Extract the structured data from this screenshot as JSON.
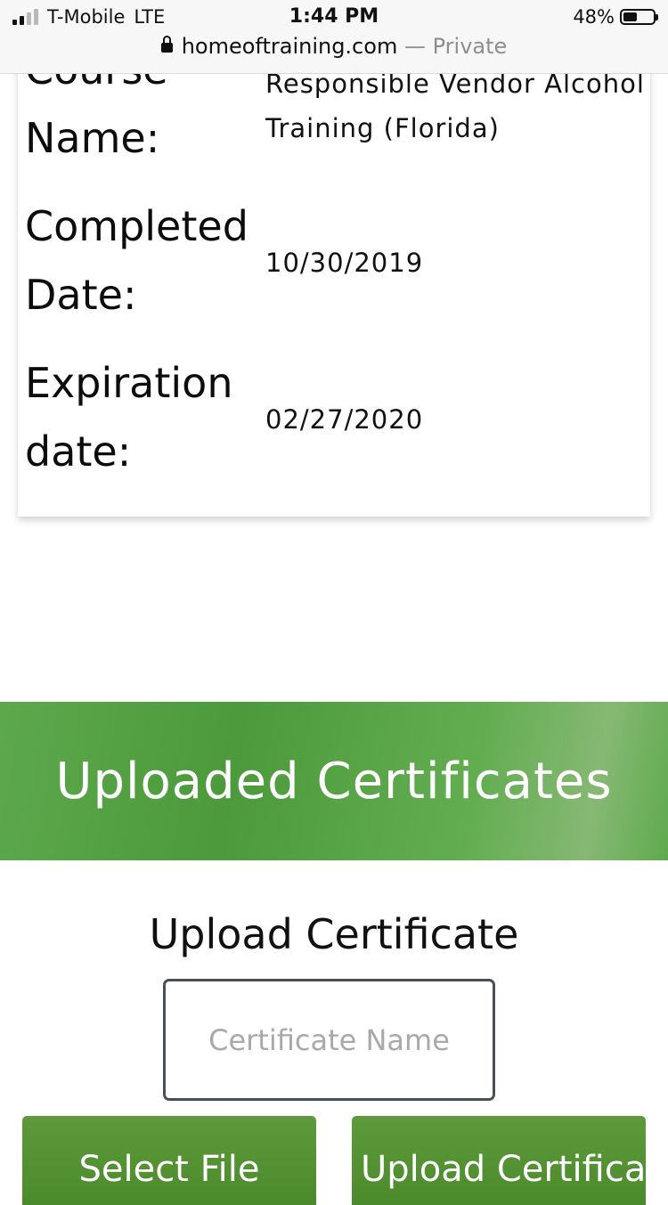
{
  "status_bar": {
    "carrier": "T-Mobile",
    "network": "LTE",
    "time": "1:44 PM",
    "battery_text": "48%",
    "battery_level": 0.48
  },
  "url_bar": {
    "domain": "homeoftraining.com",
    "separator": "—",
    "mode": "Private"
  },
  "details": {
    "course_label_top": "Course",
    "course_label_bottom": "Name:",
    "course_value_line1": "Responsible Vendor Alcohol",
    "course_value_line2": "Training (Florida)",
    "completed_label_top": "Completed",
    "completed_label_bottom": "Date:",
    "completed_value": "10/30/2019",
    "expiration_label_top": "Expiration",
    "expiration_label_bottom": "date:",
    "expiration_value": "02/27/2020"
  },
  "banner": {
    "title": "Uploaded Certificates"
  },
  "upload": {
    "title": "Upload Certificate",
    "name_placeholder": "Certificate Name",
    "select_file_label": "Select File",
    "upload_button_label": "Upload Certificate"
  },
  "colors": {
    "banner_green": "#4c9a3c",
    "button_green": "#5e9a3c"
  }
}
